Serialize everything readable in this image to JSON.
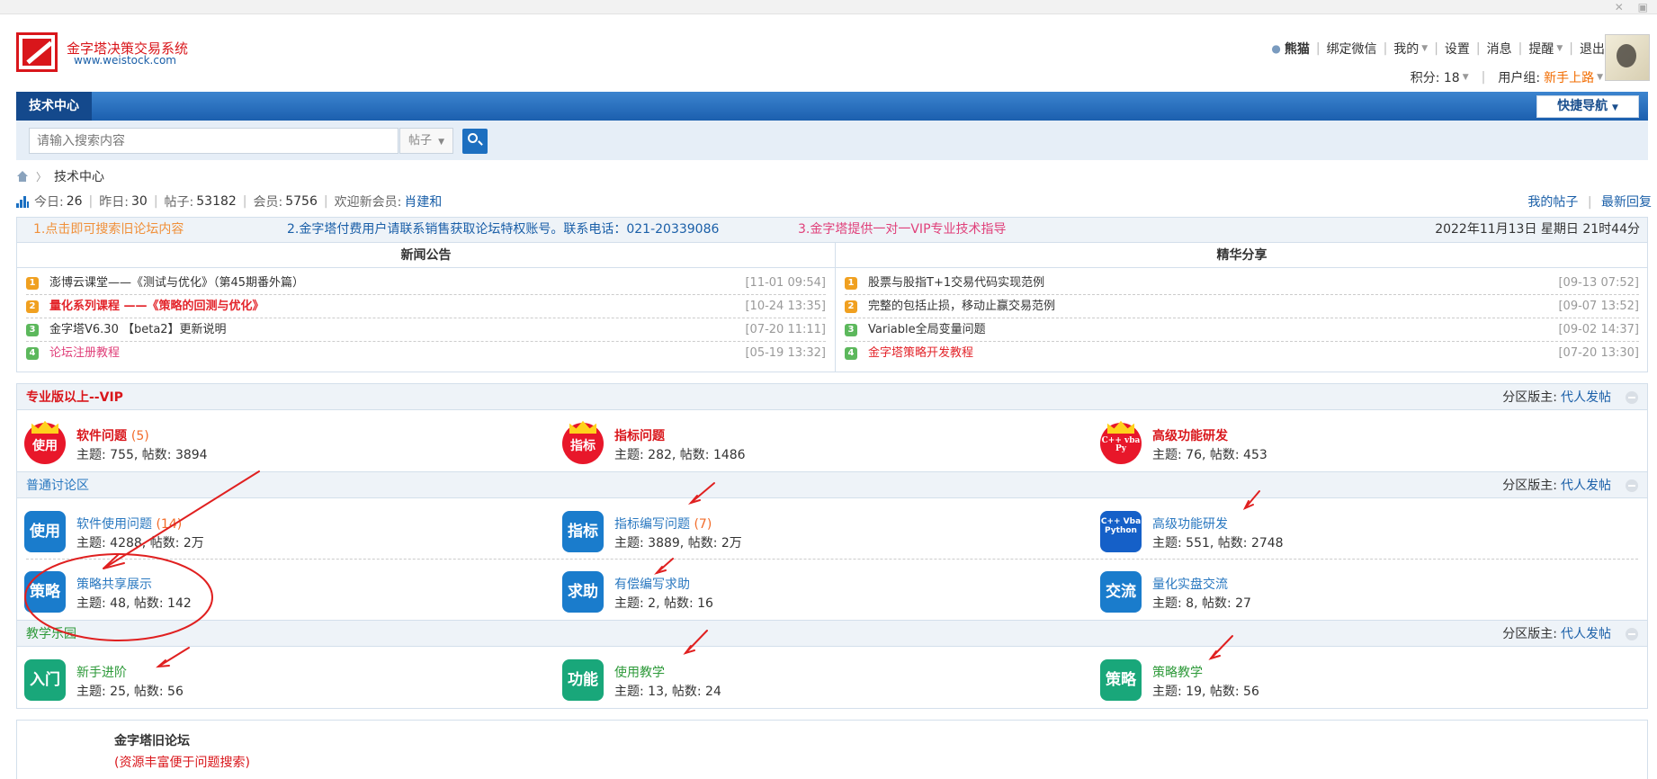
{
  "header": {
    "brand_name": "金字塔决策交易系统",
    "brand_url": "www.weistock.com",
    "nav": {
      "username": "熊猫",
      "bind_wechat": "绑定微信",
      "mine": "我的",
      "settings": "设置",
      "messages": "消息",
      "reminders": "提醒",
      "logout": "退出"
    },
    "points_label": "积分: 18",
    "group_label": "用户组:",
    "group_value": "新手上路"
  },
  "navbar": {
    "active_tab": "技术中心",
    "quick_nav": "快捷导航"
  },
  "search": {
    "placeholder": "请输入搜索内容",
    "type": "帖子"
  },
  "breadcrumb": {
    "current": "技术中心"
  },
  "stats": {
    "today_label": "今日:",
    "today": "26",
    "yesterday_label": "昨日:",
    "yesterday": "30",
    "posts_label": "帖子:",
    "posts": "53182",
    "members_label": "会员:",
    "members": "5756",
    "welcome_label": "欢迎新会员:",
    "new_member": "肖建和",
    "my_posts": "我的帖子",
    "latest_replies": "最新回复"
  },
  "notice": {
    "item1": "1.点击即可搜索旧论坛内容",
    "item2": "2.金字塔付费用户请联系销售获取论坛特权账号。联系电话：021-20339086",
    "item3": "3.金字塔提供一对一VIP专业技术指导",
    "datetime": "2022年11月13日 星期日 21时44分"
  },
  "news": {
    "title": "新闻公告",
    "items": [
      {
        "rank": "1",
        "title": "澎博云课堂——《测试与优化》（第45期番外篇）",
        "time": "[11-01 09:54]"
      },
      {
        "rank": "2",
        "title": "量化系列课程 ——《策略的回测与优化》",
        "time": "[10-24 13:35]"
      },
      {
        "rank": "3",
        "title": "金字塔V6.30 【beta2】更新说明",
        "time": "[07-20 11:11]"
      },
      {
        "rank": "4",
        "title": "论坛注册教程",
        "time": "[05-19 13:32]"
      }
    ]
  },
  "featured": {
    "title": "精华分享",
    "items": [
      {
        "rank": "1",
        "title": "股票与股指T+1交易代码实现范例",
        "time": "[09-13 07:52]"
      },
      {
        "rank": "2",
        "title": "完整的包括止损，移动止赢交易范例",
        "time": "[09-07 13:52]"
      },
      {
        "rank": "3",
        "title": "Variable全局变量问题",
        "time": "[09-02 14:37]"
      },
      {
        "rank": "4",
        "title": "金字塔策略开发教程",
        "time": "[07-20 13:30]"
      }
    ]
  },
  "sections": {
    "moderator_label": "分区版主:",
    "moderator_link": "代人发帖",
    "vip": {
      "title": "专业版以上--VIP",
      "boards": [
        {
          "icon": "使用",
          "name": "软件问题",
          "count": "(5)",
          "stats": "主题: 755, 帖数: 3894"
        },
        {
          "icon": "指标",
          "name": "指标问题",
          "count": "",
          "stats": "主题: 282, 帖数: 1486"
        },
        {
          "icon": "C++ vba Py",
          "name": "高级功能研发",
          "count": "",
          "stats": "主题: 76, 帖数: 453"
        }
      ]
    },
    "normal": {
      "title": "普通讨论区",
      "boards": [
        {
          "icon": "使用",
          "name": "软件使用问题",
          "count": "(14)",
          "stats": "主题: 4288, 帖数: 2万"
        },
        {
          "icon": "指标",
          "name": "指标编写问题",
          "count": "(7)",
          "stats": "主题: 3889, 帖数: 2万"
        },
        {
          "icon": "C++ Vba Python",
          "name": "高级功能研发",
          "count": "",
          "stats": "主题: 551, 帖数: 2748"
        },
        {
          "icon": "策略",
          "name": "策略共享展示",
          "count": "",
          "stats": "主题: 48, 帖数: 142"
        },
        {
          "icon": "求助",
          "name": "有偿编写求助",
          "count": "",
          "stats": "主题: 2, 帖数: 16"
        },
        {
          "icon": "交流",
          "name": "量化实盘交流",
          "count": "",
          "stats": "主题: 8, 帖数: 27"
        }
      ]
    },
    "teach": {
      "title": "教学乐园",
      "boards": [
        {
          "icon": "入门",
          "name": "新手进阶",
          "count": "",
          "stats": "主题: 25, 帖数: 56"
        },
        {
          "icon": "功能",
          "name": "使用教学",
          "count": "",
          "stats": "主题: 13, 帖数: 24"
        },
        {
          "icon": "策略",
          "name": "策略教学",
          "count": "",
          "stats": "主题: 19, 帖数: 56"
        }
      ]
    }
  },
  "old_forum": {
    "title": "金字塔旧论坛",
    "desc": "(资源丰富便于问题搜索)"
  },
  "colors": {
    "brand_red": "#d9161b",
    "nav_blue": "#1c5fae",
    "annotation_red": "#e02020"
  }
}
